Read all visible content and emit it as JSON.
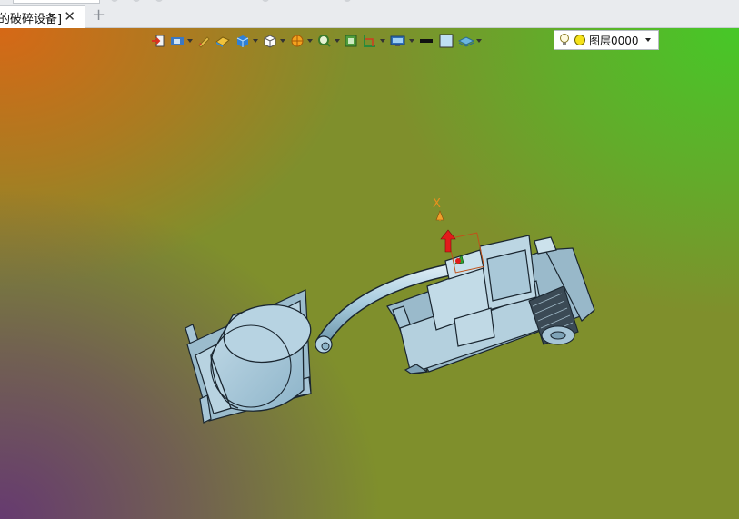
{
  "tab": {
    "title": "的破碎设备]",
    "close_icon": "close-icon",
    "add_icon": "plus-icon"
  },
  "toolbar": {
    "icons": [
      "exit-icon",
      "view-icon",
      "sketch-icon",
      "surface-icon",
      "solid-icon",
      "wireframe-icon",
      "render-icon",
      "zoom-icon",
      "fit-view-icon",
      "section-icon",
      "display-icon",
      "line-color-icon",
      "fill-icon",
      "layers-icon"
    ],
    "layer": {
      "name": "图层0000",
      "icons": [
        "bulb-icon",
        "layer-color-icon"
      ]
    }
  },
  "viewport": {
    "axis_label": "X",
    "colors": {
      "model": "#a6c5d6",
      "outline": "#1a2630",
      "axis_x": "#e8901e",
      "axis_up": "#e21b1b",
      "axis_y": "#2ea02e"
    }
  }
}
